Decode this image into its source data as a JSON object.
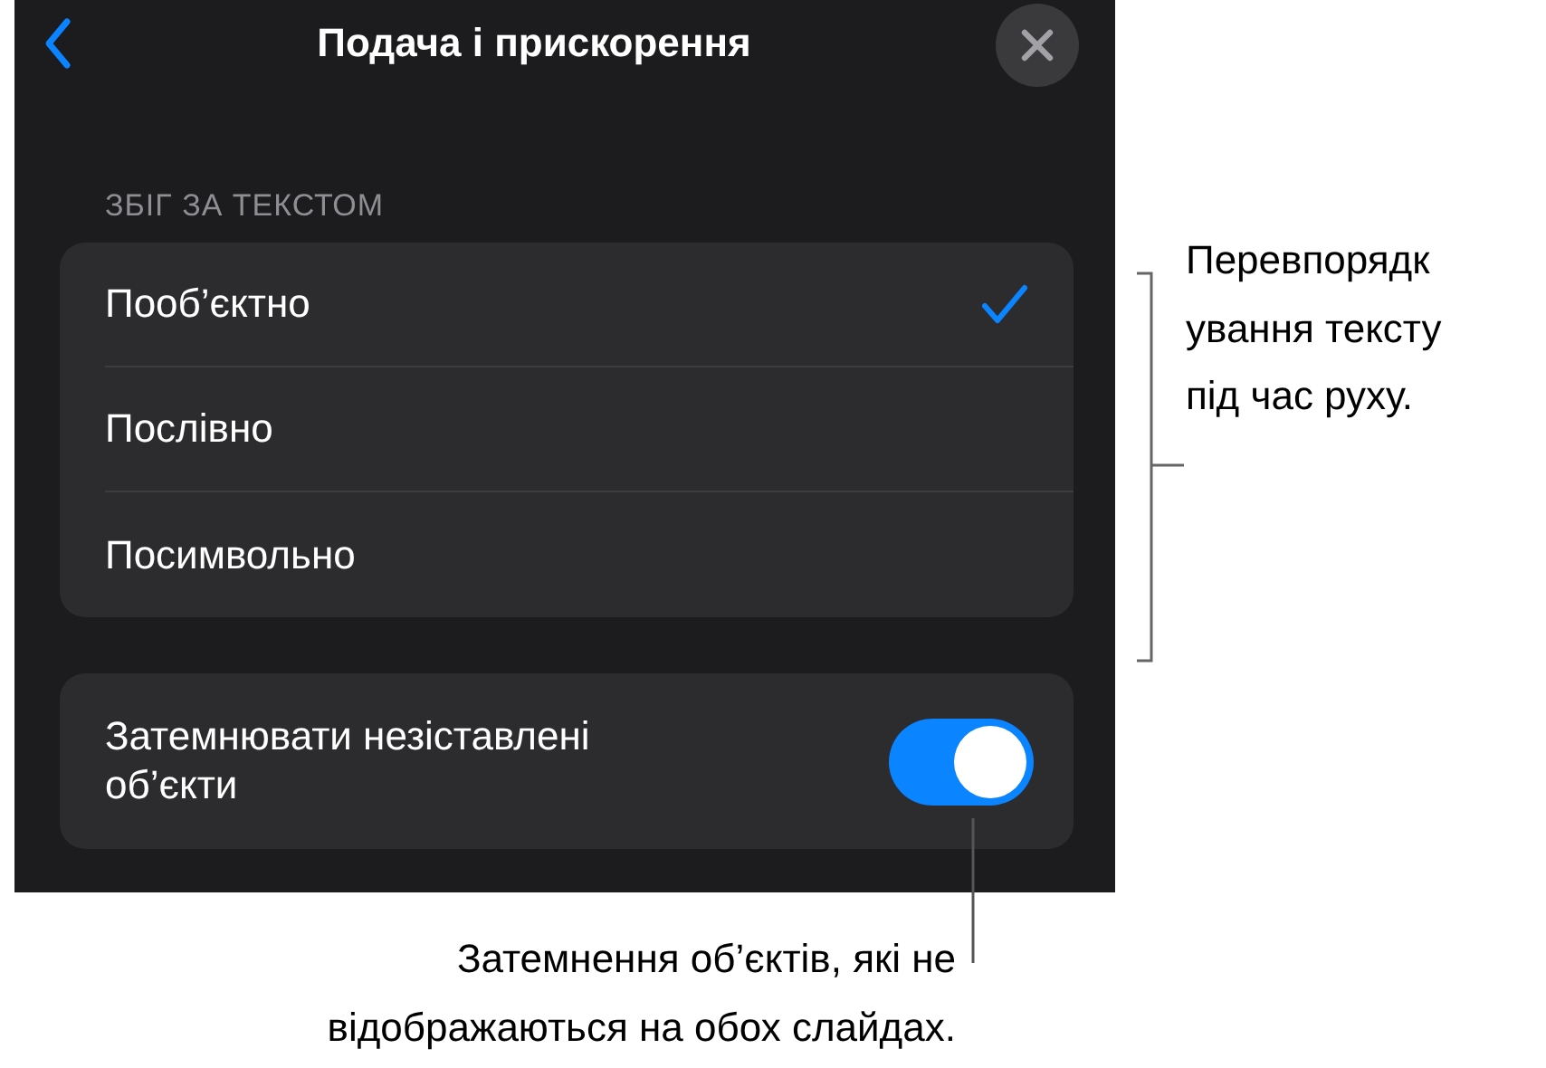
{
  "header": {
    "title": "Подача і прискорення"
  },
  "section": {
    "heading": "ЗБІГ ЗА ТЕКСТОМ",
    "options": [
      {
        "label": "Пооб’єктно",
        "selected": true
      },
      {
        "label": "Послівно",
        "selected": false
      },
      {
        "label": "Посимвольно",
        "selected": false
      }
    ]
  },
  "toggle_row": {
    "label": "Затемнювати незіставлені об’єкти",
    "on": true
  },
  "callouts": [
    {
      "kind": "side",
      "lines": [
        "Перевпорядк",
        "ування тексту",
        "під час руху."
      ]
    },
    {
      "kind": "bottom",
      "lines": [
        "Затемнення об’єктів, які не",
        "відображаються на обох слайдах."
      ]
    }
  ]
}
